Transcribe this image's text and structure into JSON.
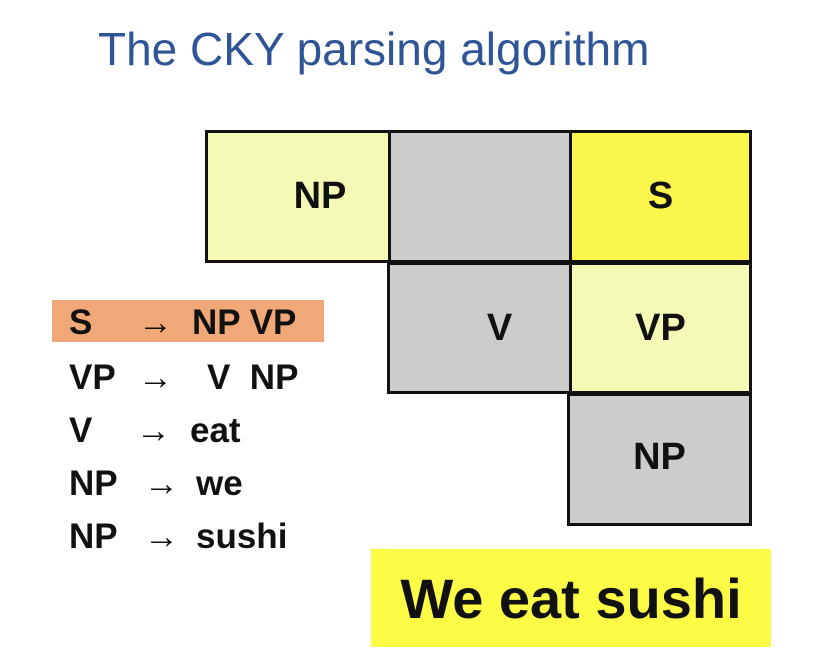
{
  "title": "The CKY parsing algorithm",
  "chart": {
    "cells": [
      {
        "id": "r0c0",
        "label": "NP",
        "fill": "#f4f9b6"
      },
      {
        "id": "r0c1",
        "label": "",
        "fill": "#cccccc"
      },
      {
        "id": "r0c2",
        "label": "S",
        "fill": "#fbf64e"
      },
      {
        "id": "r1c1",
        "label": "V",
        "fill": "#cccccc"
      },
      {
        "id": "r1c2",
        "label": "VP",
        "fill": "#f4f9b6"
      },
      {
        "id": "r2c2",
        "label": "NP",
        "fill": "#cccccc"
      }
    ]
  },
  "grammar": {
    "rules": [
      {
        "lhs": "S",
        "arrow": "→",
        "rhs": "NP VP",
        "highlighted": true,
        "highlight_color": "#f0a878"
      },
      {
        "lhs": "VP",
        "arrow": "→",
        "rhs": "V  NP",
        "highlighted": false
      },
      {
        "lhs": "V",
        "arrow": "→",
        "rhs": "eat",
        "highlighted": false
      },
      {
        "lhs": "NP",
        "arrow": "→",
        "rhs": "we",
        "highlighted": false
      },
      {
        "lhs": "NP",
        "arrow": "→",
        "rhs": "sushi",
        "highlighted": false
      }
    ]
  },
  "sentence": {
    "text": "We eat sushi",
    "highlight_color": "#fcfc47"
  }
}
